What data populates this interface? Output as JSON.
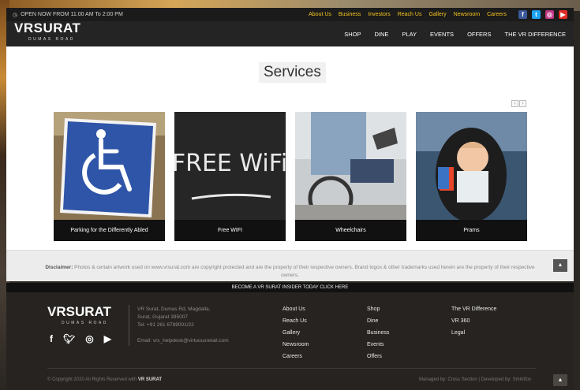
{
  "topbar": {
    "hours": "OPEN NOW FROM 11:00 AM To 2:00 PM",
    "links": [
      "About Us",
      "Business",
      "Investors",
      "Reach Us",
      "Gallery",
      "Newsroom",
      "Careers"
    ],
    "social": [
      {
        "icon": "facebook-icon",
        "glyph": "f",
        "color": "#3b5998"
      },
      {
        "icon": "twitter-icon",
        "glyph": "t",
        "color": "#1da1f2"
      },
      {
        "icon": "instagram-icon",
        "glyph": "◎",
        "color": "#c13584"
      },
      {
        "icon": "youtube-icon",
        "glyph": "▶",
        "color": "#e52d27"
      }
    ]
  },
  "nav": {
    "logo": "VRSURAT",
    "logo_sub": "DUMAS ROAD",
    "items": [
      "SHOP",
      "DINE",
      "PLAY",
      "EVENTS",
      "OFFERS",
      "THE VR DIFFERENCE"
    ]
  },
  "services": {
    "title": "Services",
    "pager_prev": "‹",
    "pager_next": "›",
    "cards": [
      {
        "caption": "Parking for the Differently Abled"
      },
      {
        "caption": "Free WIFI",
        "image_text": "FREE WiFi"
      },
      {
        "caption": "Wheelchairs"
      },
      {
        "caption": "Prams"
      }
    ]
  },
  "disclaimer": {
    "label": "Disclaimer:",
    "text": "Photos & certain artwork used on www.vrsurat.com are copyright protected and are the property of their respective owners. Brand logos & other trademarks used herein are the property of their respective owners.",
    "up": "▲"
  },
  "insider": "BECOME A VR SURAT INSIDER TODAY CLICK HERE",
  "footer": {
    "logo": "VRSURAT",
    "logo_sub": "DUMAS ROAD",
    "address": [
      "VR Surat, Dumas Rd, Magdalla,",
      "Surat, Gujarat 395007",
      "Tel: +91 261 6789001/22"
    ],
    "email": "Email: vrs_helpdesk@virtuousretail.com",
    "col1": [
      "About Us",
      "Reach Us",
      "Gallery",
      "Newsroom",
      "Careers"
    ],
    "col2": [
      "Shop",
      "Dine",
      "Business",
      "Events",
      "Offers"
    ],
    "col3": [
      "The VR Difference",
      "VR 360",
      "Legal"
    ],
    "copyright": "© Copyright 2020 All Rights Reserved with",
    "copyright_brand": "VR SURAT",
    "managed": "Managed by: Cross Section | Developed by: Smintfox",
    "up": "▲"
  }
}
